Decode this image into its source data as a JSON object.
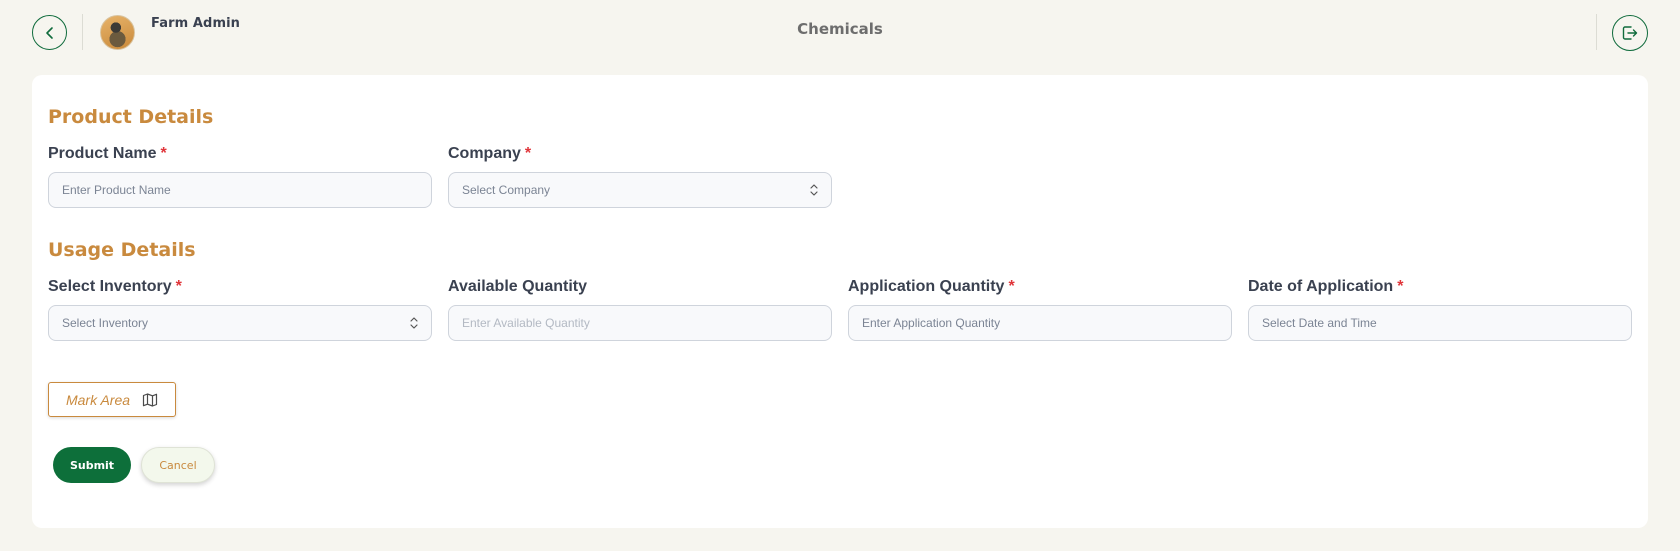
{
  "header": {
    "user_name": "Farm Admin",
    "page_title": "Chemicals"
  },
  "product_details": {
    "title": "Product Details",
    "product_name": {
      "label": "Product Name",
      "required": "*",
      "placeholder": "Enter Product Name"
    },
    "company": {
      "label": "Company",
      "required": "*",
      "placeholder": "Select Company"
    }
  },
  "usage_details": {
    "title": "Usage Details",
    "inventory": {
      "label": "Select Inventory",
      "required": "*",
      "placeholder": "Select Inventory"
    },
    "available_quantity": {
      "label": "Available Quantity",
      "placeholder": "Enter Available Quantity"
    },
    "application_quantity": {
      "label": "Application Quantity",
      "required": "*",
      "placeholder": "Enter Application Quantity"
    },
    "date_of_application": {
      "label": "Date of Application",
      "required": "*",
      "placeholder": "Select Date and Time"
    }
  },
  "actions": {
    "mark_area": "Mark Area",
    "submit": "Submit",
    "cancel": "Cancel"
  },
  "colors": {
    "primary_green": "#0d6f3a",
    "accent_orange": "#c98a3e",
    "required_red": "#e0353a",
    "background": "#f6f5ef"
  },
  "icons": {
    "back": "chevron-left-icon",
    "logout": "logout-icon",
    "map": "map-icon",
    "select": "chevron-up-down-icon"
  }
}
